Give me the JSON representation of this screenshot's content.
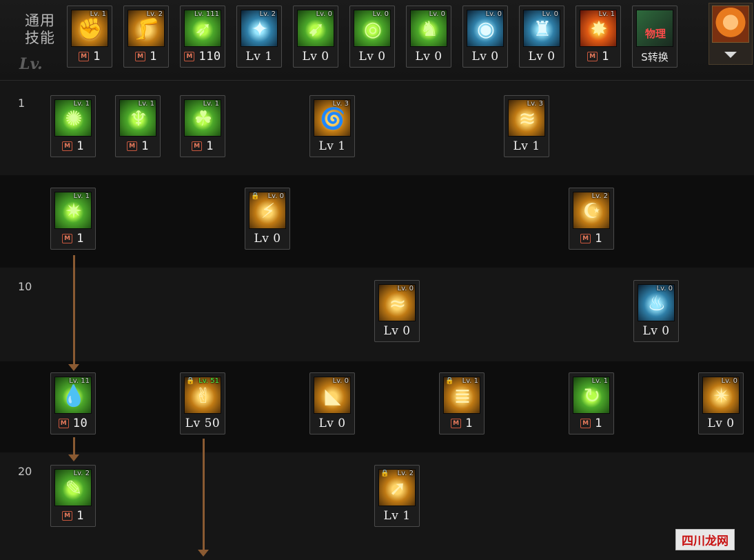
{
  "header": {
    "side_label_line1": "通用",
    "side_label_line2": "技能",
    "lv_label": "Lv."
  },
  "row_numbers": [
    "1",
    "10",
    "20"
  ],
  "watermark": "四川龙网",
  "skills": [
    {
      "id": "c1",
      "lv": "Lv. 1",
      "theme": "gold",
      "glyph": "✊",
      "badge": "M",
      "value": "1"
    },
    {
      "id": "c2",
      "lv": "Lv. 2",
      "theme": "gold",
      "glyph": "🦵",
      "badge": "M",
      "value": "1"
    },
    {
      "id": "c3",
      "lv": "Lv. 111",
      "theme": "green",
      "glyph": "➶",
      "badge": "M",
      "value": "110"
    },
    {
      "id": "c4",
      "lv": "Lv. 2",
      "theme": "blue",
      "glyph": "✦",
      "badge": "",
      "value": "Lv 1"
    },
    {
      "id": "c5",
      "lv": "Lv. 0",
      "theme": "green",
      "glyph": "➹",
      "badge": "",
      "value": "Lv 0"
    },
    {
      "id": "c6",
      "lv": "Lv. 0",
      "theme": "green",
      "glyph": "◎",
      "badge": "",
      "value": "Lv 0"
    },
    {
      "id": "c7",
      "lv": "Lv. 0",
      "theme": "green",
      "glyph": "♞",
      "badge": "",
      "value": "Lv 0"
    },
    {
      "id": "c8",
      "lv": "Lv. 0",
      "theme": "blue",
      "glyph": "◉",
      "badge": "",
      "value": "Lv 0"
    },
    {
      "id": "c9",
      "lv": "Lv. 0",
      "theme": "blue",
      "glyph": "♜",
      "badge": "",
      "value": "Lv 0"
    },
    {
      "id": "c10",
      "lv": "Lv. 1",
      "theme": "red",
      "glyph": "✸",
      "badge": "M",
      "value": "1"
    },
    {
      "id": "c11",
      "lv": "",
      "theme": "mix",
      "glyph": "物理",
      "badge": "",
      "value": "S转换"
    },
    {
      "id": "r1a",
      "lv": "Lv. 1",
      "theme": "green",
      "glyph": "✺",
      "badge": "M",
      "value": "1"
    },
    {
      "id": "r1b",
      "lv": "Lv. 1",
      "theme": "green",
      "glyph": "♆",
      "badge": "M",
      "value": "1"
    },
    {
      "id": "r1c",
      "lv": "Lv. 1",
      "theme": "green",
      "glyph": "☘",
      "badge": "M",
      "value": "1"
    },
    {
      "id": "r1d",
      "lv": "Lv. 3",
      "theme": "gold",
      "glyph": "🌀",
      "badge": "",
      "value": "Lv 1"
    },
    {
      "id": "r1e",
      "lv": "Lv. 3",
      "theme": "gold",
      "glyph": "≋",
      "badge": "",
      "value": "Lv 1"
    },
    {
      "id": "r2a",
      "lv": "Lv. 1",
      "theme": "green",
      "glyph": "✷",
      "badge": "M",
      "value": "1"
    },
    {
      "id": "r2b",
      "lv": "Lv. 0",
      "theme": "gold",
      "glyph": "⚡",
      "badge": "",
      "value": "Lv 0",
      "lock": "🔒"
    },
    {
      "id": "r2c",
      "lv": "Lv. 2",
      "theme": "gold",
      "glyph": "☪",
      "badge": "M",
      "value": "1"
    },
    {
      "id": "r3a",
      "lv": "Lv. 0",
      "theme": "gold",
      "glyph": "≈",
      "badge": "",
      "value": "Lv 0"
    },
    {
      "id": "r3b",
      "lv": "Lv. 0",
      "theme": "blue",
      "glyph": "♨",
      "badge": "",
      "value": "Lv 0"
    },
    {
      "id": "r4a",
      "lv": "Lv. 11",
      "theme": "green",
      "glyph": "💧",
      "badge": "M",
      "value": "10"
    },
    {
      "id": "r4b",
      "lv": "Lv. 51",
      "theme": "gold",
      "glyph": "✌",
      "badge": "",
      "value": "Lv 50",
      "lock": "🔒",
      "hi": true
    },
    {
      "id": "r4c",
      "lv": "Lv. 0",
      "theme": "gold",
      "glyph": "◣",
      "badge": "",
      "value": "Lv 0"
    },
    {
      "id": "r4d",
      "lv": "Lv. 1",
      "theme": "gold",
      "glyph": "≣",
      "badge": "M",
      "value": "1",
      "lock": "🔒"
    },
    {
      "id": "r4e",
      "lv": "Lv. 1",
      "theme": "green",
      "glyph": "↻",
      "badge": "M",
      "value": "1"
    },
    {
      "id": "r4f",
      "lv": "Lv. 0",
      "theme": "gold",
      "glyph": "✴",
      "badge": "",
      "value": "Lv 0"
    },
    {
      "id": "r5a",
      "lv": "Lv. 2",
      "theme": "green",
      "glyph": "✎",
      "badge": "M",
      "value": "1"
    },
    {
      "id": "r5b",
      "lv": "Lv. 2",
      "theme": "gold",
      "glyph": "➚",
      "badge": "",
      "value": "Lv 1",
      "lock": "🔒"
    }
  ]
}
